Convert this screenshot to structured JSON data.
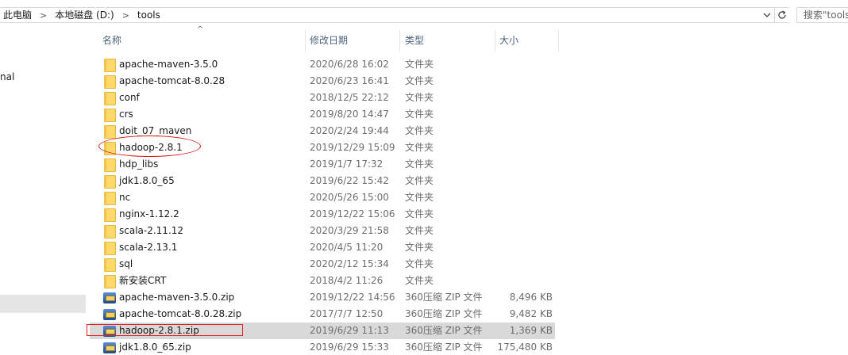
{
  "address_bar": {
    "crumbs": [
      "此电脑",
      "本地磁盘 (D:)",
      "tools"
    ],
    "search_placeholder": "搜索\"tools\""
  },
  "sidebar": {
    "items": [
      {
        "label": "nal"
      }
    ]
  },
  "columns": {
    "name": "名称",
    "date": "修改日期",
    "type": "类型",
    "size": "大小"
  },
  "files": [
    {
      "name": "apache-maven-3.5.0",
      "date": "2020/6/28 16:02",
      "type": "文件夹",
      "size": "",
      "icon": "folder-icon"
    },
    {
      "name": "apache-tomcat-8.0.28",
      "date": "2020/6/23 16:41",
      "type": "文件夹",
      "size": "",
      "icon": "folder-icon"
    },
    {
      "name": "conf",
      "date": "2018/12/5 22:12",
      "type": "文件夹",
      "size": "",
      "icon": "folder-icon"
    },
    {
      "name": "crs",
      "date": "2019/8/20 14:47",
      "type": "文件夹",
      "size": "",
      "icon": "folder-icon"
    },
    {
      "name": "doit_07_maven",
      "date": "2020/2/24 19:44",
      "type": "文件夹",
      "size": "",
      "icon": "folder-icon"
    },
    {
      "name": "hadoop-2.8.1",
      "date": "2019/12/29 15:09",
      "type": "文件夹",
      "size": "",
      "icon": "folder-icon"
    },
    {
      "name": "hdp_libs",
      "date": "2019/1/7 17:32",
      "type": "文件夹",
      "size": "",
      "icon": "folder-icon"
    },
    {
      "name": "jdk1.8.0_65",
      "date": "2019/6/22 15:42",
      "type": "文件夹",
      "size": "",
      "icon": "folder-icon"
    },
    {
      "name": "nc",
      "date": "2020/5/26 15:00",
      "type": "文件夹",
      "size": "",
      "icon": "folder-icon"
    },
    {
      "name": "nginx-1.12.2",
      "date": "2019/12/22 15:06",
      "type": "文件夹",
      "size": "",
      "icon": "folder-icon"
    },
    {
      "name": "scala-2.11.12",
      "date": "2020/3/29 21:58",
      "type": "文件夹",
      "size": "",
      "icon": "folder-icon"
    },
    {
      "name": "scala-2.13.1",
      "date": "2020/4/5 11:20",
      "type": "文件夹",
      "size": "",
      "icon": "folder-icon"
    },
    {
      "name": "sql",
      "date": "2020/2/12 15:34",
      "type": "文件夹",
      "size": "",
      "icon": "folder-icon"
    },
    {
      "name": "新安装CRT",
      "date": "2018/4/2 11:26",
      "type": "文件夹",
      "size": "",
      "icon": "folder-icon"
    },
    {
      "name": "apache-maven-3.5.0.zip",
      "date": "2019/12/22 14:56",
      "type": "360压缩 ZIP 文件",
      "size": "8,496 KB",
      "icon": "zip-icon"
    },
    {
      "name": "apache-tomcat-8.0.28.zip",
      "date": "2017/7/7 12:50",
      "type": "360压缩 ZIP 文件",
      "size": "9,482 KB",
      "icon": "zip-icon"
    },
    {
      "name": "hadoop-2.8.1.zip",
      "date": "2019/6/29 11:13",
      "type": "360压缩 ZIP 文件",
      "size": "1,369 KB",
      "icon": "zip-icon",
      "selected": true
    },
    {
      "name": "jdk1.8.0_65.zip",
      "date": "2019/6/29 15:33",
      "type": "360压缩 ZIP 文件",
      "size": "175,480 KB",
      "icon": "zip-icon"
    }
  ],
  "colors": {
    "annotation": "#d91e1e",
    "selected_row": "#d9d9d9",
    "header_text": "#4c607a"
  }
}
